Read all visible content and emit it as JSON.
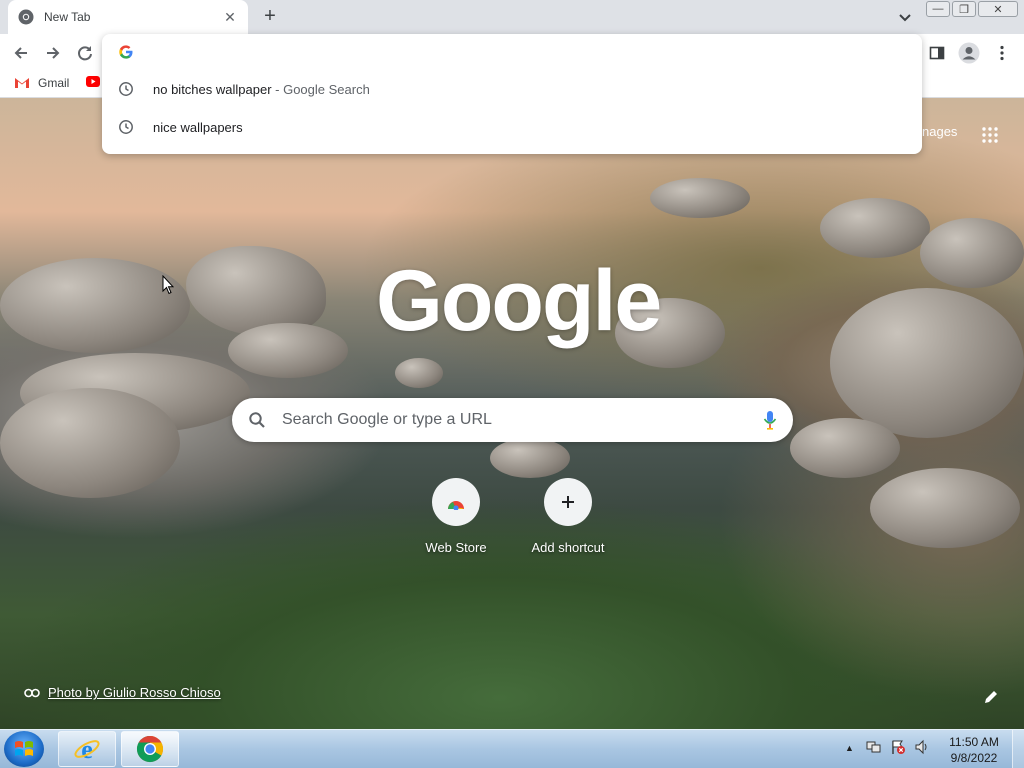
{
  "browser": {
    "tab": {
      "title": "New Tab",
      "close_glyph": "✕"
    },
    "new_tab_glyph": "+",
    "window_controls": {
      "minimize": "—",
      "restore": "❐",
      "close": "✕"
    },
    "bookmarks": [
      {
        "label": "Gmail",
        "icon": "gmail-icon"
      },
      {
        "label": "",
        "icon": "youtube-icon"
      }
    ],
    "colors": {
      "chrome_frame": "#dee1e6",
      "toolbar": "#ffffff"
    }
  },
  "omnibox": {
    "value": "",
    "suggestions": [
      {
        "text": "no bitches wallpaper",
        "suffix": " - Google Search",
        "icon": "history-clock-icon"
      },
      {
        "text": "nice wallpapers",
        "suffix": "",
        "icon": "history-clock-icon"
      }
    ]
  },
  "ntp": {
    "top_right_link": "nages",
    "logo_text": "Google",
    "search_placeholder": "Search Google or type a URL",
    "shortcuts": [
      {
        "label": "Web Store",
        "icon": "web-store-icon"
      },
      {
        "label": "Add shortcut",
        "icon": "plus-icon"
      }
    ],
    "attribution": "Photo by Giulio Rosso Chioso"
  },
  "taskbar": {
    "items": [
      {
        "name": "internet-explorer",
        "icon": "ie-icon"
      },
      {
        "name": "chrome",
        "icon": "chrome-icon",
        "active": true
      }
    ],
    "tray_show_hidden": "▲",
    "clock_time": "11:50 AM",
    "clock_date": "9/8/2022"
  }
}
